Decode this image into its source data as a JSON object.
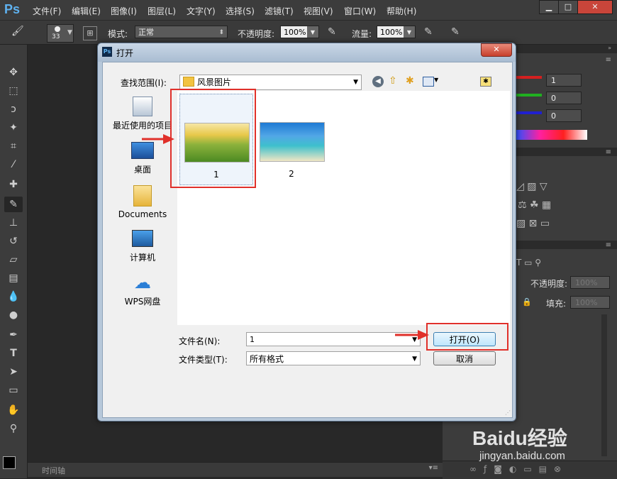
{
  "app": {
    "logo": "Ps"
  },
  "menu": [
    "文件(F)",
    "编辑(E)",
    "图像(I)",
    "图层(L)",
    "文字(Y)",
    "选择(S)",
    "滤镜(T)",
    "视图(V)",
    "窗口(W)",
    "帮助(H)"
  ],
  "window_controls": {
    "minimize": "▁",
    "maximize": "□",
    "close": "✕"
  },
  "options_bar": {
    "brush_size": "33",
    "mode_label": "模式:",
    "mode_value": "正常",
    "opacity_label": "不透明度:",
    "opacity_value": "100%",
    "flow_label": "流量:",
    "flow_value": "100%"
  },
  "color_panel": {
    "r": "1",
    "g": "0",
    "b": "0"
  },
  "layers_panel": {
    "opacity_label": "不透明度:",
    "opacity_value": "100%",
    "fill_label": "填充:",
    "fill_value": "100%"
  },
  "timeline": {
    "label": "时间轴"
  },
  "dialog": {
    "title": "打开",
    "look_in_label": "查找范围(I):",
    "look_in_value": "风景图片",
    "places": [
      "最近使用的项目",
      "桌面",
      "Documents",
      "计算机",
      "WPS网盘"
    ],
    "files": [
      {
        "name": "1",
        "selected": true
      },
      {
        "name": "2",
        "selected": false
      }
    ],
    "filename_label": "文件名(N):",
    "filename_value": "1",
    "filetype_label": "文件类型(T):",
    "filetype_value": "所有格式",
    "open_button": "打开(O)",
    "cancel_button": "取消"
  },
  "watermark": {
    "brand": "Baidu经验",
    "url": "jingyan.baidu.com"
  },
  "colors": {
    "accent_red": "#e0302a",
    "ps_blue": "#5fb2f0"
  }
}
